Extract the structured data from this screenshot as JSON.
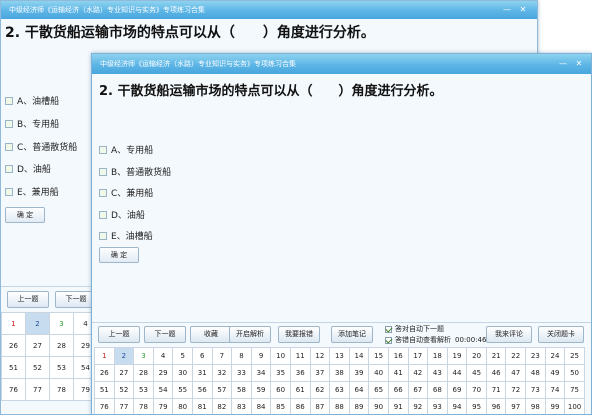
{
  "windows": [
    {
      "title": "中级经济师《运输经济（水路）专业知识与实务》专项练习合集",
      "question": "2. 干散货船运输市场的特点可以从（　　）角度进行分析。",
      "options": [
        "A、油槽船",
        "B、专用船",
        "C、普通散货船",
        "D、油船",
        "E、兼用船"
      ],
      "confirm_label": "确 定",
      "nav": {
        "prev": "上一题",
        "next": "下一题"
      },
      "grid_rows": [
        [
          "1",
          "2",
          "3",
          "4"
        ],
        [
          "26",
          "27",
          "28",
          "29"
        ],
        [
          "51",
          "52",
          "53",
          "54"
        ],
        [
          "76",
          "77",
          "78",
          "79"
        ]
      ]
    },
    {
      "title": "中级经济师《运输经济（水路）专业知识与实务》专项练习合集",
      "question": "2. 干散货船运输市场的特点可以从（　　）角度进行分析。",
      "options": [
        "A、专用船",
        "B、普通散货船",
        "C、兼用船",
        "D、油船",
        "E、油槽船"
      ],
      "confirm_label": "确 定",
      "toolbar": {
        "prev": "上一题",
        "next": "下一题",
        "favorite": "收藏",
        "show_analysis": "开启解析",
        "report_error": "我要报错",
        "add_note": "添加笔记",
        "auto_next": "答对自动下一题",
        "auto_analysis": "答错自动查看解析",
        "timer": "00:00:46",
        "comment": "我来评论",
        "close_card": "关闭题卡"
      },
      "grid_rows": [
        [
          "1",
          "2",
          "3",
          "4",
          "5",
          "6",
          "7",
          "8",
          "9",
          "10",
          "11",
          "12",
          "13",
          "14",
          "15",
          "16",
          "17",
          "18",
          "19",
          "20",
          "21",
          "22",
          "23",
          "24",
          "25"
        ],
        [
          "26",
          "27",
          "28",
          "29",
          "30",
          "31",
          "32",
          "33",
          "34",
          "35",
          "36",
          "37",
          "38",
          "39",
          "40",
          "41",
          "42",
          "43",
          "44",
          "45",
          "46",
          "47",
          "48",
          "49",
          "50"
        ],
        [
          "51",
          "52",
          "53",
          "54",
          "55",
          "56",
          "57",
          "58",
          "59",
          "60",
          "61",
          "62",
          "63",
          "64",
          "65",
          "66",
          "67",
          "68",
          "69",
          "70",
          "71",
          "72",
          "73",
          "74",
          "75"
        ],
        [
          "76",
          "77",
          "78",
          "79",
          "80",
          "81",
          "82",
          "83",
          "84",
          "85",
          "86",
          "87",
          "88",
          "89",
          "90",
          "91",
          "92",
          "93",
          "94",
          "95",
          "96",
          "97",
          "98",
          "99",
          "100"
        ]
      ]
    }
  ],
  "colors": {
    "titlebar": "#5cb5e6",
    "current_cell": "#c8dcf0",
    "first_cell_text": "#d02020",
    "third_cell_text": "#2a9a2a"
  }
}
